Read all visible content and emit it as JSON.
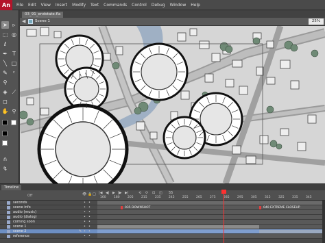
{
  "app": {
    "logo": "An",
    "menu": [
      "File",
      "Edit",
      "View",
      "Insert",
      "Modify",
      "Text",
      "Commands",
      "Control",
      "Debug",
      "Window",
      "Help"
    ]
  },
  "document": {
    "tab_label": "03_91_endstate.fla",
    "scene_label": "Scene 1",
    "zoom": "25%"
  },
  "timeline": {
    "panel_tab": "Timeline",
    "off_label": "Off",
    "ticks": [
      "160",
      "180",
      "205",
      "215",
      "235",
      "245",
      "255",
      "265",
      "275",
      "285",
      "295",
      "305",
      "315",
      "325",
      "335",
      "345"
    ],
    "controls": [
      "|◀",
      "◀|",
      "▶",
      "|▶",
      "▶|",
      "⟲",
      "⟳",
      "⊡",
      "◫",
      "55"
    ],
    "layers": [
      {
        "name": "seconds",
        "selected": false
      },
      {
        "name": "scene info",
        "selected": false
      },
      {
        "name": "audio (music)",
        "selected": false
      },
      {
        "name": "audio (dialog)",
        "selected": false
      },
      {
        "name": "coming soon",
        "selected": false
      },
      {
        "name": "scene 1",
        "selected": false
      },
      {
        "name": "scene 2",
        "selected": true
      },
      {
        "name": "reference",
        "selected": false
      }
    ],
    "frame_labels": {
      "scene_info_a": "035 DOWNSHOT",
      "scene_info_b": "040 EXTREME CLOSEUP"
    }
  },
  "colors": {
    "stage_bg": "#d4d4d4",
    "selection_blue": "#7f9ecf",
    "playhead": "#ff3030",
    "logo": "#b3142a"
  }
}
